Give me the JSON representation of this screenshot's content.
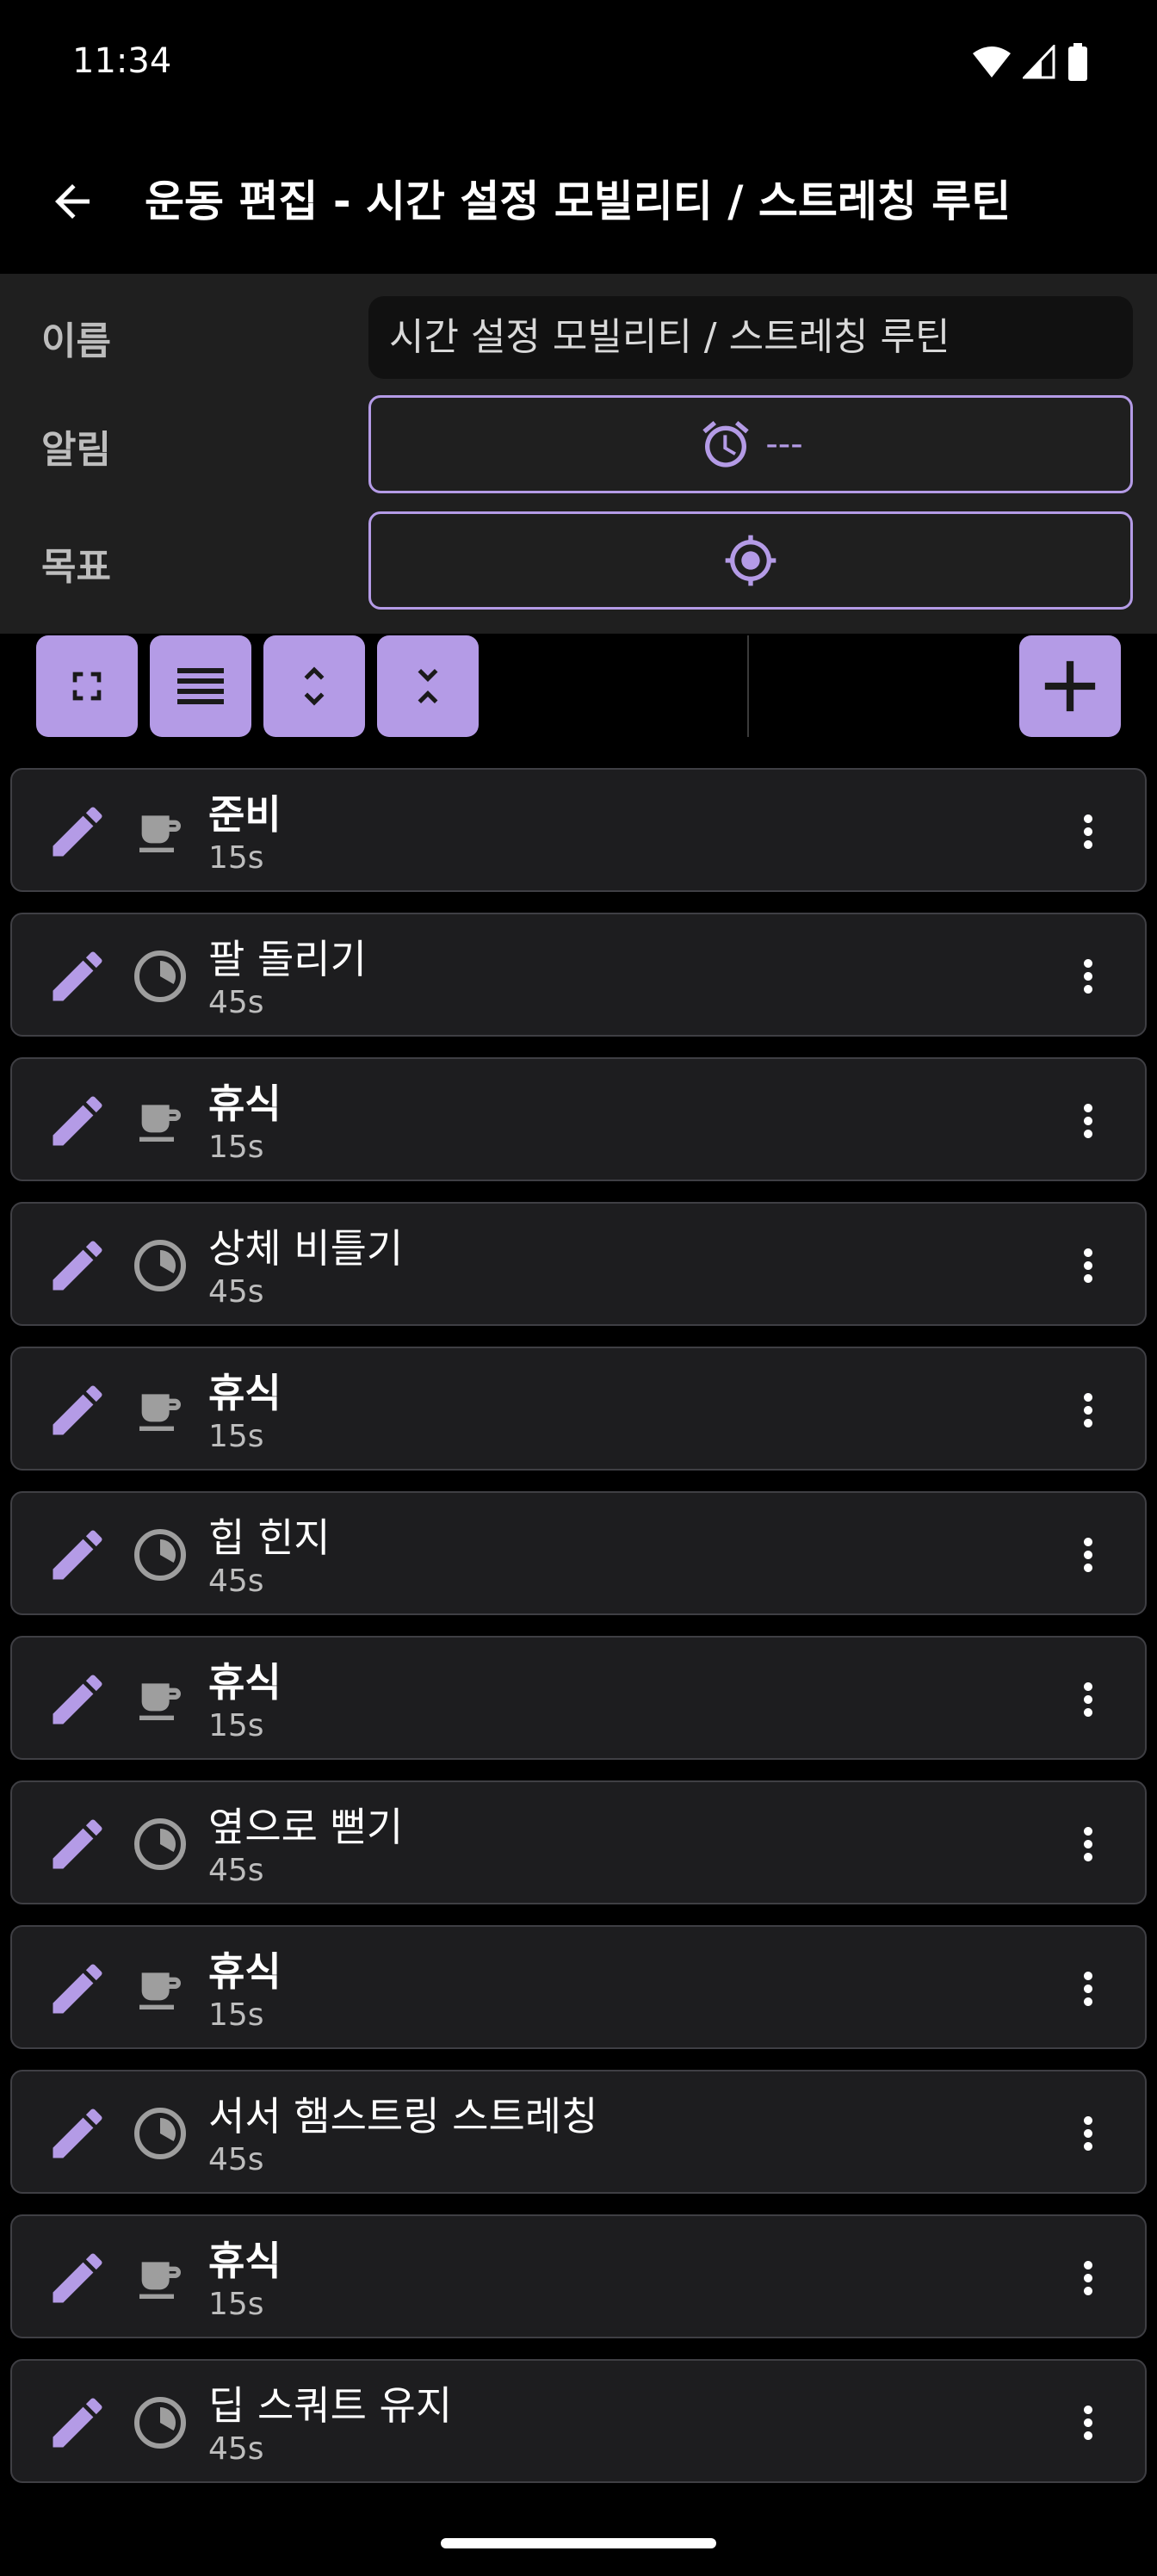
{
  "status_bar": {
    "time": "11:34"
  },
  "app_bar": {
    "title": "운동 편집 - 시간 설정 모빌리티 / 스트레칭 루틴"
  },
  "form": {
    "name_label": "이름",
    "name_value": "시간 설정 모빌리티 / 스트레칭 루틴",
    "alarm_label": "알림",
    "alarm_value": "---",
    "goal_label": "목표"
  },
  "colors": {
    "accent": "#b49be6",
    "background": "#000000",
    "panel": "#1f1f1f",
    "item_bg": "#1d1d1f"
  },
  "list": {
    "items": [
      {
        "name": "준비",
        "duration": "15s",
        "type": "rest",
        "icon": "coffee-icon"
      },
      {
        "name": "팔 돌리기",
        "duration": "45s",
        "type": "exercise",
        "icon": "timer-pie-icon"
      },
      {
        "name": "휴식",
        "duration": "15s",
        "type": "rest",
        "icon": "coffee-icon"
      },
      {
        "name": "상체 비틀기",
        "duration": "45s",
        "type": "exercise",
        "icon": "timer-pie-icon"
      },
      {
        "name": "휴식",
        "duration": "15s",
        "type": "rest",
        "icon": "coffee-icon"
      },
      {
        "name": "힙 힌지",
        "duration": "45s",
        "type": "exercise",
        "icon": "timer-pie-icon"
      },
      {
        "name": "휴식",
        "duration": "15s",
        "type": "rest",
        "icon": "coffee-icon"
      },
      {
        "name": "옆으로 뻗기",
        "duration": "45s",
        "type": "exercise",
        "icon": "timer-pie-icon"
      },
      {
        "name": "휴식",
        "duration": "15s",
        "type": "rest",
        "icon": "coffee-icon"
      },
      {
        "name": "서서 햄스트링 스트레칭",
        "duration": "45s",
        "type": "exercise",
        "icon": "timer-pie-icon"
      },
      {
        "name": "휴식",
        "duration": "15s",
        "type": "rest",
        "icon": "coffee-icon"
      },
      {
        "name": "딥 스쿼트 유지",
        "duration": "45s",
        "type": "exercise",
        "icon": "timer-pie-icon"
      }
    ]
  }
}
